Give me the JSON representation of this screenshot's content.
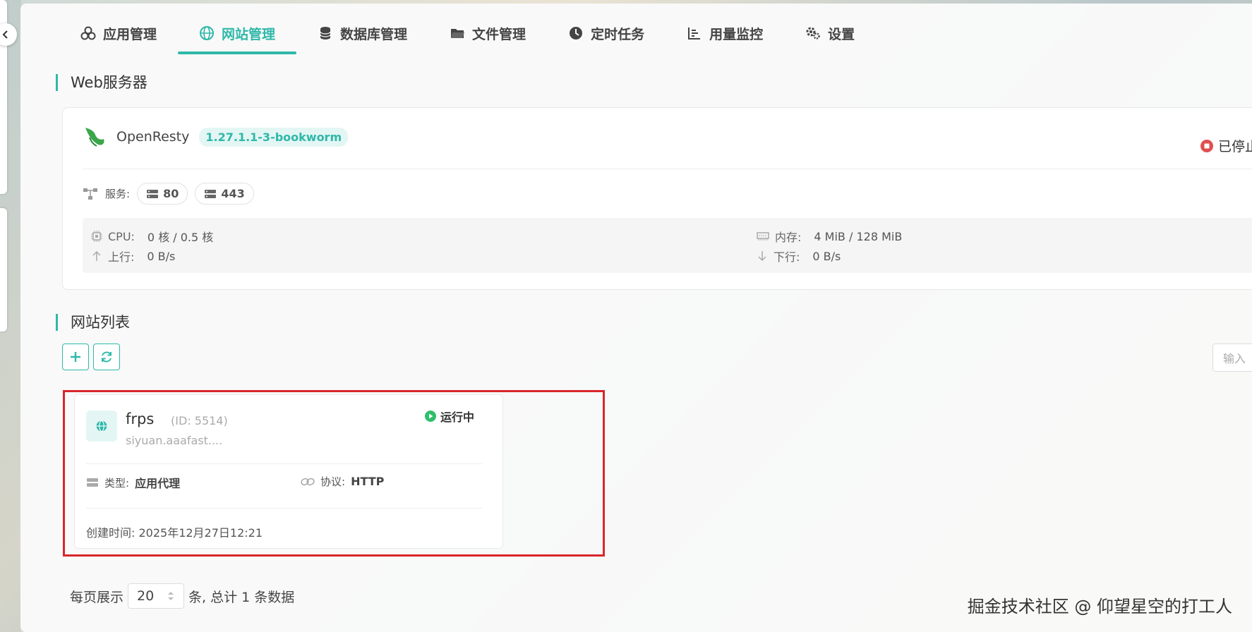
{
  "tabs": [
    {
      "label": "应用管理",
      "icon": "apps-icon"
    },
    {
      "label": "网站管理",
      "icon": "globe-icon",
      "active": true
    },
    {
      "label": "数据库管理",
      "icon": "database-icon"
    },
    {
      "label": "文件管理",
      "icon": "folder-icon"
    },
    {
      "label": "定时任务",
      "icon": "clock-icon"
    },
    {
      "label": "用量监控",
      "icon": "chart-icon"
    },
    {
      "label": "设置",
      "icon": "gears-icon"
    }
  ],
  "web_server": {
    "section_title": "Web服务器",
    "name": "OpenResty",
    "version": "1.27.1.1-3-bookworm",
    "status": "已停止",
    "services_label": "服务:",
    "ports": [
      "80",
      "443"
    ],
    "cpu_label": "CPU:",
    "cpu_value": "0 核 / 0.5 核",
    "mem_label": "内存:",
    "mem_value": "4 MiB / 128 MiB",
    "up_label": "上行:",
    "up_value": "0 B/s",
    "down_label": "下行:",
    "down_value": "0 B/s"
  },
  "site_list": {
    "section_title": "网站列表",
    "search_placeholder": "输入",
    "sites": [
      {
        "name": "frps",
        "id": "(ID: 5514)",
        "domain": "siyuan.aaafast....",
        "status": "运行中",
        "type_label": "类型:",
        "type_value": "应用代理",
        "protocol_label": "协议:",
        "protocol_value": "HTTP",
        "created": "创建时间: 2025年12月27日12:21"
      }
    ]
  },
  "pager": {
    "prefix": "每页展示",
    "page_size": "20",
    "suffix": "条, 总计 1 条数据"
  },
  "watermark": "掘金技术社区 @ 仰望星空的打工人",
  "colors": {
    "accent": "#2fb8a9",
    "stopped": "#e04f4f",
    "running": "#2ebf6b",
    "highlight": "#d9262b"
  }
}
